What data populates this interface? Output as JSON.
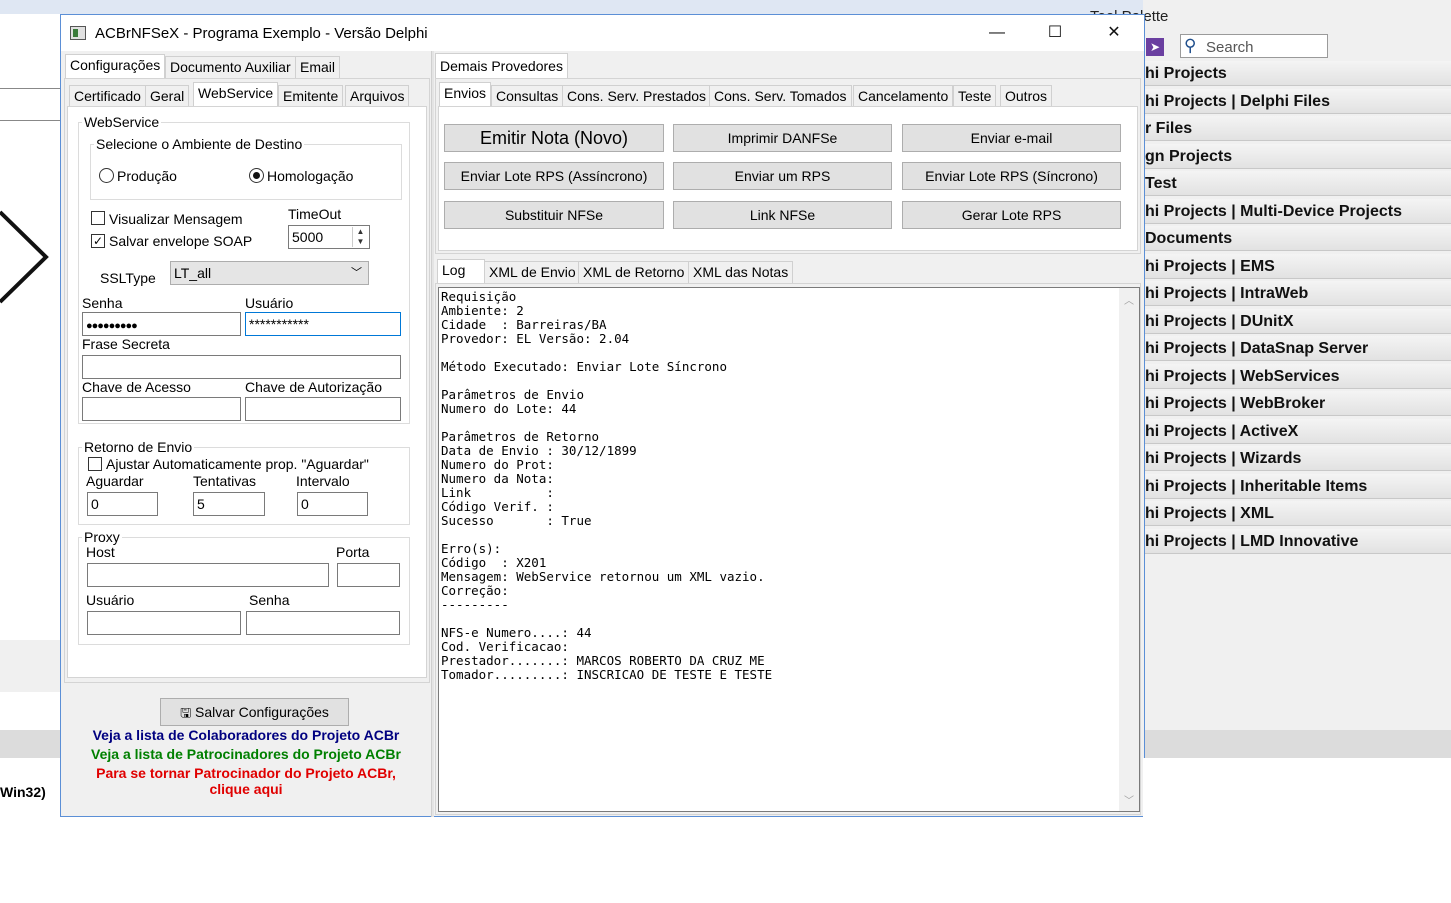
{
  "background": {
    "win32_label": "Win32)",
    "palette": {
      "title": "Tool Palette",
      "search_placeholder": "Search",
      "items": [
        "hi Projects",
        "hi Projects | Delphi Files",
        "r Files",
        "gn Projects",
        "Test",
        "hi Projects | Multi-Device Projects",
        "Documents",
        "hi Projects | EMS",
        "hi Projects | IntraWeb",
        "hi Projects | DUnitX",
        "hi Projects | DataSnap Server",
        "hi Projects | WebServices",
        "hi Projects | WebBroker",
        "hi Projects | ActiveX",
        "hi Projects | Wizards",
        "hi Projects | Inheritable Items",
        "hi Projects | XML",
        "hi Projects | LMD Innovative"
      ]
    }
  },
  "window": {
    "title": "ACBrNFSeX - Programa Exemplo - Versão Delphi",
    "caption_buttons": {
      "minimize": "—",
      "maximize": "☐",
      "close": "✕"
    }
  },
  "left": {
    "top_tabs": [
      "Configurações",
      "Documento Auxiliar",
      "Email"
    ],
    "sub_tabs": [
      "Certificado",
      "Geral",
      "WebService",
      "Emitente",
      "Arquivos"
    ],
    "webservice": {
      "group_label": "WebService",
      "ambiente_label": "Selecione o Ambiente de Destino",
      "radio_producao": "Produção",
      "radio_homologacao": "Homologação",
      "chk_visualizar": "Visualizar Mensagem",
      "chk_salvar": "Salvar envelope SOAP",
      "timeout_label": "TimeOut",
      "timeout_value": "5000",
      "ssltype_label": "SSLType",
      "ssltype_value": "LT_all",
      "senha_label": "Senha",
      "senha_value": "●●●●●●●●●",
      "usuario_label": "Usuário",
      "usuario_value": "***********",
      "frase_label": "Frase Secreta",
      "chave_acesso_label": "Chave de Acesso",
      "chave_autorizacao_label": "Chave de Autorização"
    },
    "retorno": {
      "group_label": "Retorno de Envio",
      "chk_ajustar": "Ajustar Automaticamente prop. \"Aguardar\"",
      "aguardar_label": "Aguardar",
      "aguardar_value": "0",
      "tentativas_label": "Tentativas",
      "tentativas_value": "5",
      "intervalo_label": "Intervalo",
      "intervalo_value": "0"
    },
    "proxy": {
      "group_label": "Proxy",
      "host_label": "Host",
      "porta_label": "Porta",
      "usuario_label": "Usuário",
      "senha_label": "Senha"
    },
    "salvar_button": "Salvar Configurações",
    "link_colaboradores": "Veja a lista de Colaboradores do Projeto ACBr",
    "link_patrocinadores": "Veja a lista de Patrocinadores do Projeto ACBr",
    "link_patrocinador_1": "Para se tornar Patrocinador do Projeto ACBr,",
    "link_patrocinador_2": "clique aqui",
    "colors": {
      "colaboradores": "#000080",
      "patrocinadores": "#008000",
      "tornar": "#e00000"
    }
  },
  "right": {
    "top_tab": "Demais Provedores",
    "sub_tabs": [
      "Envios",
      "Consultas",
      "Cons. Serv. Prestados",
      "Cons. Serv. Tomados",
      "Cancelamento",
      "Teste",
      "Outros"
    ],
    "buttons": [
      "Emitir Nota (Novo)",
      "Imprimir DANFSe",
      "Enviar e-mail",
      "Enviar Lote RPS (Assíncrono)",
      "Enviar um RPS",
      "Enviar Lote RPS (Síncrono)",
      "Substituir NFSe",
      "Link NFSe",
      "Gerar Lote RPS"
    ],
    "log_tabs": [
      "Log",
      "XML de Envio",
      "XML de Retorno",
      "XML das Notas"
    ],
    "log_text": "Requisição\nAmbiente: 2\nCidade  : Barreiras/BA\nProvedor: EL Versão: 2.04\n\nMétodo Executado: Enviar Lote Síncrono\n\nParâmetros de Envio\nNumero do Lote: 44\n\nParâmetros de Retorno\nData de Envio : 30/12/1899\nNumero do Prot:\nNumero da Nota:\nLink          :\nCódigo Verif. :\nSucesso       : True\n\nErro(s):\nCódigo  : X201\nMensagem: WebService retornou um XML vazio.\nCorreção:\n---------\n\nNFS-e Numero....: 44\nCod. Verificacao:\nPrestador.......: MARCOS ROBERTO DA CRUZ ME\nTomador.........: INSCRICAO DE TESTE E TESTE"
  }
}
